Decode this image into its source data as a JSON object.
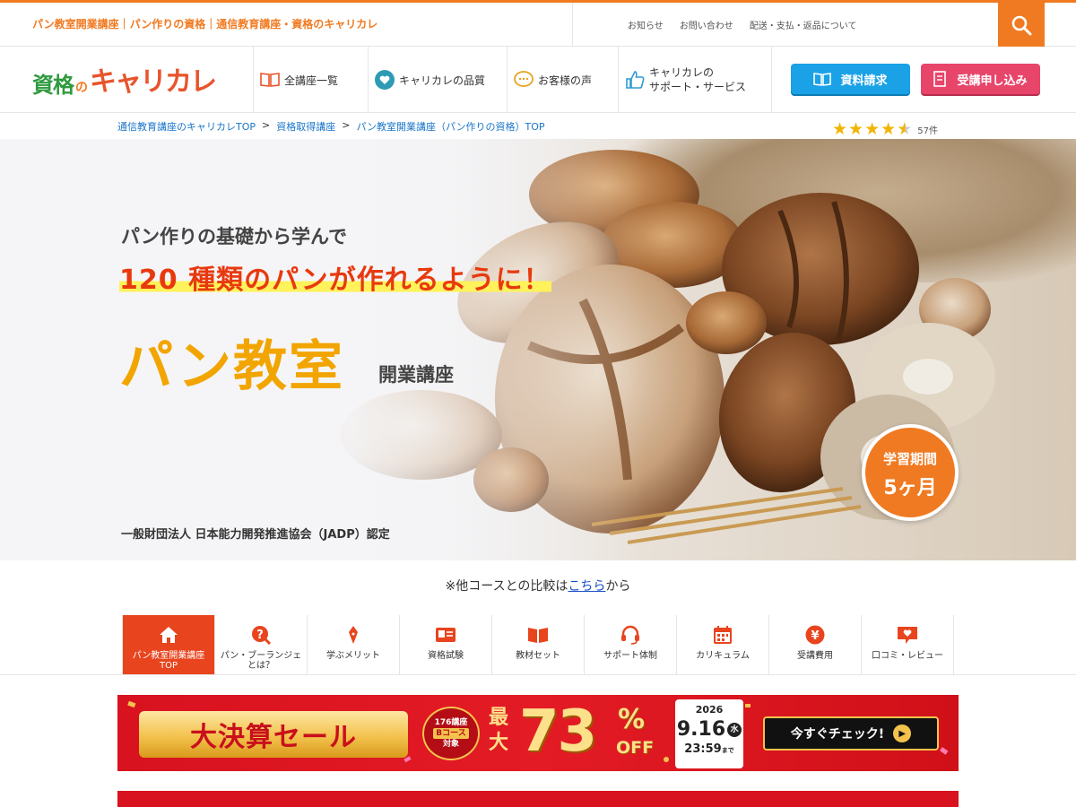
{
  "topbar": {
    "tagline": "パン教室開業講座｜パン作りの資格｜通信教育講座・資格のキャリカレ",
    "links": [
      "お知らせ",
      "お問い合わせ",
      "配送・支払・返品について"
    ]
  },
  "header": {
    "logo": {
      "part1": "資格",
      "part2": "の",
      "part3": "キャリカレ"
    },
    "nav": [
      {
        "label": "全講座一覧",
        "icon": "book-icon"
      },
      {
        "label": "キャリカレの品質",
        "icon": "heart-icon"
      },
      {
        "label": "お客様の声",
        "icon": "speech-bubble-icon"
      },
      {
        "label": "キャリカレの\nサポート・サービス",
        "icon": "thumbs-up-icon"
      }
    ],
    "request_button": "資料請求",
    "apply_button": "受講申し込み"
  },
  "breadcrumb": [
    "通信教育講座のキャリカレTOP",
    "資格取得講座",
    "パン教室開業講座（パン作りの資格）TOP"
  ],
  "rating": {
    "stars": 4.5,
    "count": "57件"
  },
  "hero": {
    "subtitle": "パン作りの基礎から学んで",
    "highlight": "120 種類のパンが作れるように！",
    "title": "パン教室",
    "title_suffix": "開業講座",
    "certification": "一般財団法人 日本能力開発推進協会（JADP）認定",
    "period_label": "学習期間",
    "period_value": "5ヶ月"
  },
  "compare": {
    "prefix": "※他コースとの比較は",
    "link": "こちら",
    "suffix": "から"
  },
  "course_nav": [
    {
      "label": "パン教室開業講座\nTOP",
      "icon": "home-icon"
    },
    {
      "label": "パン・ブーランジェ\nとは？",
      "icon": "question-icon"
    },
    {
      "label": "学ぶメリット",
      "icon": "pen-icon"
    },
    {
      "label": "資格試験",
      "icon": "id-card-icon"
    },
    {
      "label": "教材セット",
      "icon": "open-book-icon"
    },
    {
      "label": "サポート体制",
      "icon": "headset-icon"
    },
    {
      "label": "カリキュラム",
      "icon": "calendar-icon"
    },
    {
      "label": "受講費用",
      "icon": "yen-icon"
    },
    {
      "label": "口コミ・レビュー",
      "icon": "review-heart-icon"
    }
  ],
  "sale": {
    "title": "大決算セール",
    "badge_line1": "176講座",
    "badge_course": "Bコース",
    "badge_line3": "対象",
    "max": "最大",
    "percent": "73",
    "percent_sign": "%",
    "off": "OFF",
    "year": "2026",
    "date": "9.16",
    "weekday": "水",
    "time": "23:59",
    "time_suffix": "まで",
    "cta": "今すぐチェック!"
  },
  "colors": {
    "accent": "#f07a21",
    "nav_active": "#e8451e",
    "request": "#1aa1e6",
    "apply": "#e8456b",
    "sale": "#d8121f"
  }
}
